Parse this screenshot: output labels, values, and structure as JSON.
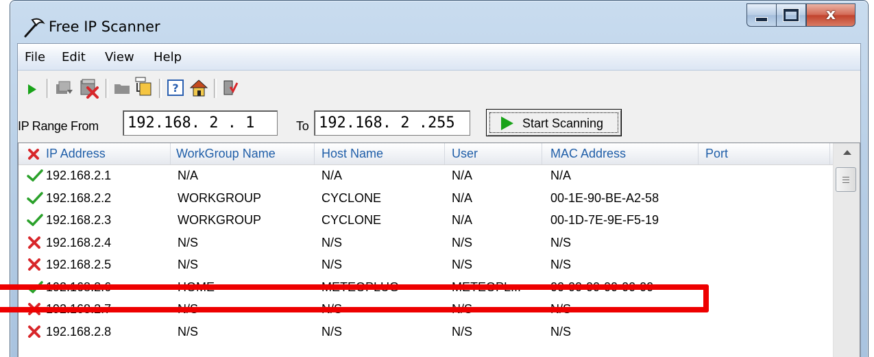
{
  "window": {
    "title": "Free IP Scanner",
    "controls": {
      "minimize": "minimize",
      "maximize": "maximize",
      "close": "x"
    }
  },
  "menu": [
    "File",
    "Edit",
    "View",
    "Help"
  ],
  "toolbar": {
    "icons": [
      "play-icon",
      "export-icon",
      "delete-icon",
      "folder-icon",
      "open-file-icon",
      "help-icon",
      "home-icon",
      "exit-icon"
    ]
  },
  "range": {
    "from_label": "IP Range From",
    "from_value": "192.168. 2 . 1",
    "to_label": "To",
    "to_value": "192.168. 2 .255",
    "start_label": "Start Scanning"
  },
  "table": {
    "columns": [
      "IP Address",
      "WorkGroup Name",
      "Host Name",
      "User",
      "MAC Address",
      "Port"
    ],
    "rows": [
      {
        "status": "up",
        "ip": "192.168.2.1",
        "workgroup": "N/A",
        "host": "N/A",
        "user": "N/A",
        "mac": "N/A"
      },
      {
        "status": "up",
        "ip": "192.168.2.2",
        "workgroup": "WORKGROUP",
        "host": "CYCLONE",
        "user": "N/A",
        "mac": "00-1E-90-BE-A2-58"
      },
      {
        "status": "up",
        "ip": "192.168.2.3",
        "workgroup": "WORKGROUP",
        "host": "CYCLONE",
        "user": "N/A",
        "mac": "00-1D-7E-9E-F5-19"
      },
      {
        "status": "down",
        "ip": "192.168.2.4",
        "workgroup": "N/S",
        "host": "N/S",
        "user": "N/S",
        "mac": "N/S"
      },
      {
        "status": "down",
        "ip": "192.168.2.5",
        "workgroup": "N/S",
        "host": "N/S",
        "user": "N/S",
        "mac": "N/S"
      },
      {
        "status": "up",
        "ip": "192.168.2.6",
        "workgroup": "HOME",
        "host": "METEOPLUG",
        "user": "METEOPL...",
        "mac": "00-00-00-00-00-00"
      },
      {
        "status": "down",
        "ip": "192.168.2.7",
        "workgroup": "N/S",
        "host": "N/S",
        "user": "N/S",
        "mac": "N/S"
      },
      {
        "status": "down",
        "ip": "192.168.2.8",
        "workgroup": "N/S",
        "host": "N/S",
        "user": "N/S",
        "mac": "N/S"
      }
    ]
  },
  "colors": {
    "header_text": "#1f5ea8",
    "status_up": "#2aa12a",
    "status_down": "#d8262a",
    "highlight": "#ee0000"
  }
}
